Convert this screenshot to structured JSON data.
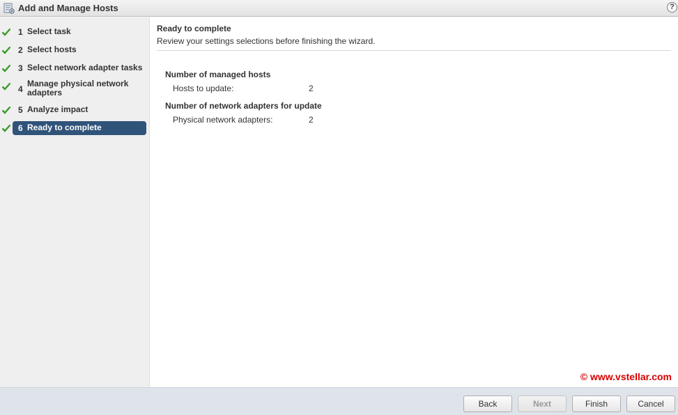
{
  "window": {
    "title": "Add and Manage Hosts",
    "help_label": "?"
  },
  "steps": [
    {
      "num": "1",
      "label": "Select task",
      "done": true,
      "active": false
    },
    {
      "num": "2",
      "label": "Select hosts",
      "done": true,
      "active": false
    },
    {
      "num": "3",
      "label": "Select network adapter tasks",
      "done": true,
      "active": false
    },
    {
      "num": "4",
      "label": "Manage physical network adapters",
      "done": true,
      "active": false
    },
    {
      "num": "5",
      "label": "Analyze impact",
      "done": true,
      "active": false
    },
    {
      "num": "6",
      "label": "Ready to complete",
      "done": true,
      "active": true
    }
  ],
  "main": {
    "title": "Ready to complete",
    "subtitle": "Review your settings selections before finishing the wizard.",
    "sections": [
      {
        "title": "Number of managed hosts",
        "rows": [
          {
            "label": "Hosts to update:",
            "value": "2"
          }
        ]
      },
      {
        "title": "Number of network adapters for update",
        "rows": [
          {
            "label": "Physical network adapters:",
            "value": "2"
          }
        ]
      }
    ],
    "watermark": "© www.vstellar.com"
  },
  "footer": {
    "back": "Back",
    "next": "Next",
    "finish": "Finish",
    "cancel": "Cancel"
  },
  "colors": {
    "active_step": "#30537a",
    "check": "#3a9a2a",
    "watermark": "#d80000"
  }
}
